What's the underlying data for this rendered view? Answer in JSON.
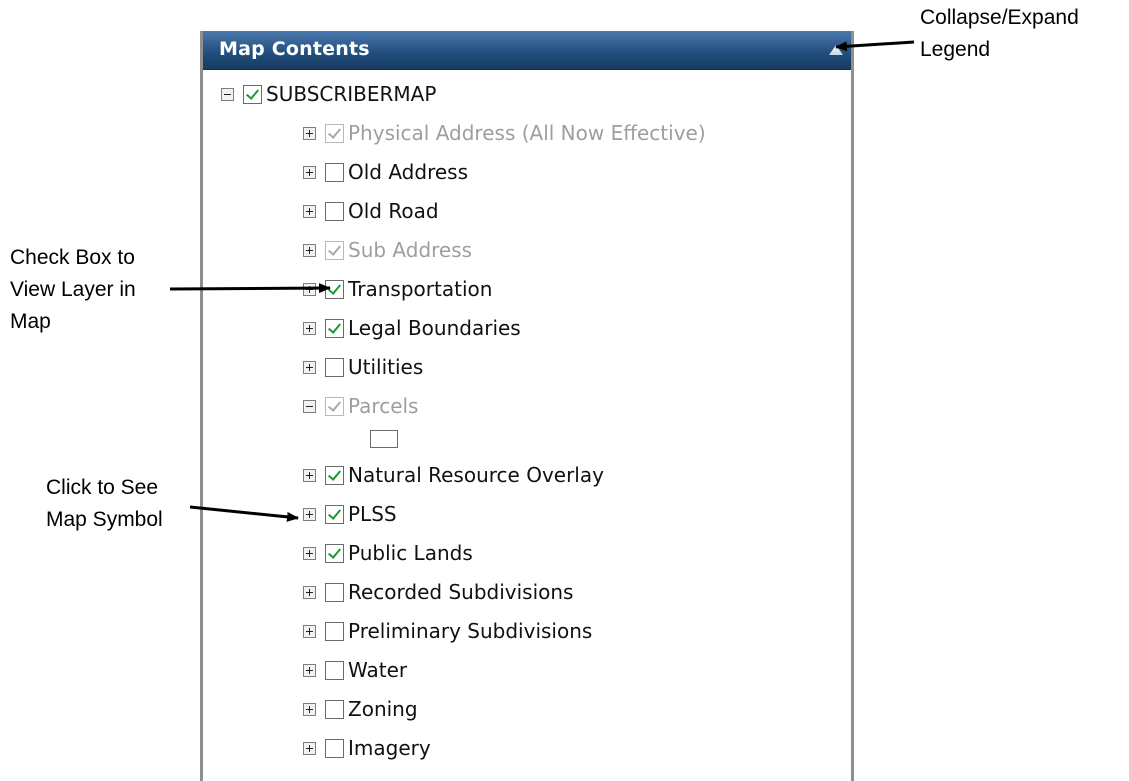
{
  "panel": {
    "title": "Map Contents",
    "collapse_icon": "triangle-up-icon"
  },
  "tree": {
    "root": {
      "label": "SUBSCRIBERMAP",
      "expanded": true,
      "checked": true
    },
    "layers": [
      {
        "label": "Physical Address (All Now Effective)",
        "checked": true,
        "disabled": true,
        "expanded": false
      },
      {
        "label": "Old Address",
        "checked": false,
        "disabled": false,
        "expanded": false
      },
      {
        "label": "Old Road",
        "checked": false,
        "disabled": false,
        "expanded": false
      },
      {
        "label": "Sub Address",
        "checked": true,
        "disabled": true,
        "expanded": false
      },
      {
        "label": "Transportation",
        "checked": true,
        "disabled": false,
        "expanded": false
      },
      {
        "label": "Legal Boundaries",
        "checked": true,
        "disabled": false,
        "expanded": false
      },
      {
        "label": "Utilities",
        "checked": false,
        "disabled": false,
        "expanded": false
      },
      {
        "label": "Parcels",
        "checked": true,
        "disabled": true,
        "expanded": true
      },
      {
        "label": "Natural Resource Overlay",
        "checked": true,
        "disabled": false,
        "expanded": false
      },
      {
        "label": "PLSS",
        "checked": true,
        "disabled": false,
        "expanded": false
      },
      {
        "label": "Public Lands",
        "checked": true,
        "disabled": false,
        "expanded": false
      },
      {
        "label": "Recorded Subdivisions",
        "checked": false,
        "disabled": false,
        "expanded": false
      },
      {
        "label": "Preliminary Subdivisions",
        "checked": false,
        "disabled": false,
        "expanded": false
      },
      {
        "label": "Water",
        "checked": false,
        "disabled": false,
        "expanded": false
      },
      {
        "label": "Zoning",
        "checked": false,
        "disabled": false,
        "expanded": false
      },
      {
        "label": "Imagery",
        "checked": false,
        "disabled": false,
        "expanded": false
      }
    ]
  },
  "annotations": {
    "collapse": "Collapse/Expand\nLegend",
    "checkbox": "Check Box to\nView Layer in\nMap",
    "symbol": "Click to See\nMap Symbol"
  },
  "colors": {
    "header_top": "#4c79ad",
    "header_bottom": "#163c62",
    "check_green": "#1d9a2f",
    "disabled_text": "#9e9e9e"
  }
}
